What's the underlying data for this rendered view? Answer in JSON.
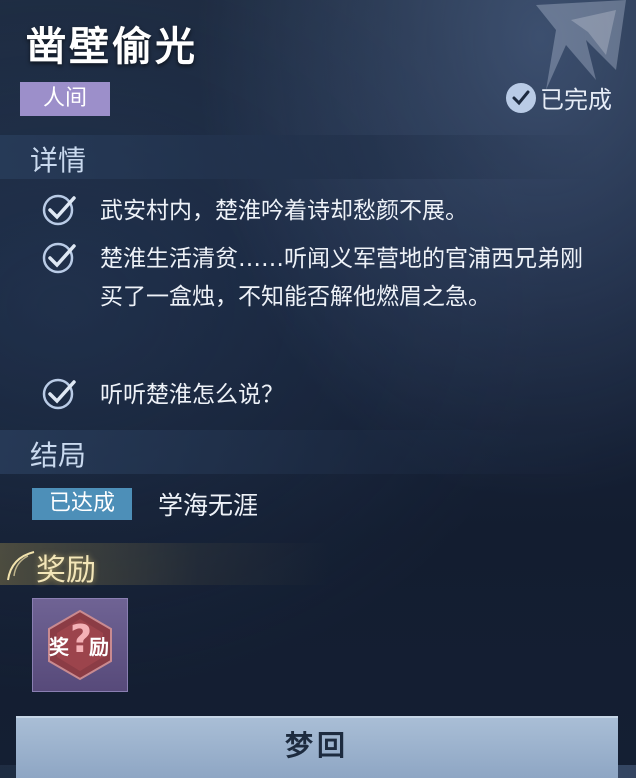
{
  "quest": {
    "title": "凿壁偷光",
    "realm_tag": "人间",
    "status": "已完成"
  },
  "details": {
    "heading": "详情",
    "tasks": [
      "武安村内，楚淮吟着诗却愁颜不展。",
      "楚淮生活清贫……听闻义军营地的官浦西兄弟刚买了一盒烛，不知能否解他燃眉之急。",
      "听听楚淮怎么说？"
    ]
  },
  "ending": {
    "heading": "结局",
    "badge": "已达成",
    "name": "学海无涯"
  },
  "reward": {
    "heading": "奖励",
    "item_label_left": "奖",
    "item_label_right": "励",
    "item_symbol": "?"
  },
  "action": {
    "button_label": "梦回"
  },
  "colors": {
    "realm_tag_bg": "#9c8fca",
    "ending_badge_bg": "#4d8fb8",
    "check_color": "#b9cbe6"
  }
}
